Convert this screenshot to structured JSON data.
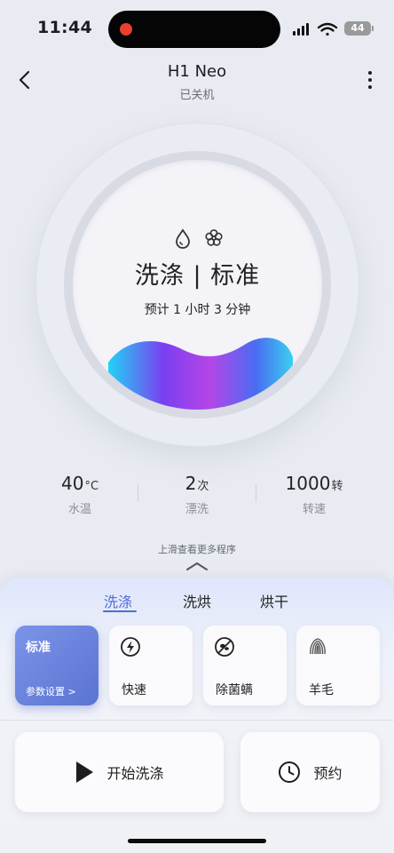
{
  "status_bar": {
    "time": "11:44",
    "battery": "44"
  },
  "header": {
    "title": "H1 Neo",
    "subtitle": "已关机"
  },
  "dial": {
    "mode": "洗涤 | 标准",
    "estimate": "预计 1 小时 3 分钟",
    "icons": [
      "water-drop-icon",
      "flower-icon"
    ]
  },
  "stats": [
    {
      "value": "40",
      "unit": "°C",
      "label": "水温"
    },
    {
      "value": "2",
      "unit": "次",
      "label": "漂洗"
    },
    {
      "value": "1000",
      "unit": "转",
      "label": "转速"
    }
  ],
  "more_hint": "上滑查看更多程序",
  "tabs": [
    {
      "label": "洗涤",
      "active": true
    },
    {
      "label": "洗烘",
      "active": false
    },
    {
      "label": "烘干",
      "active": false
    }
  ],
  "programs": [
    {
      "label": "标准",
      "settings": "参数设置 >",
      "selected": true
    },
    {
      "label": "快速",
      "icon": "lightning-icon"
    },
    {
      "label": "除菌螨",
      "icon": "no-mite-icon"
    },
    {
      "label": "羊毛",
      "icon": "wool-icon"
    }
  ],
  "actions": {
    "start": "开始洗涤",
    "schedule": "预约"
  },
  "colors": {
    "accent": "#4f6cd6",
    "selected_card": "#6b84dd",
    "background": "#e8ebf1"
  }
}
